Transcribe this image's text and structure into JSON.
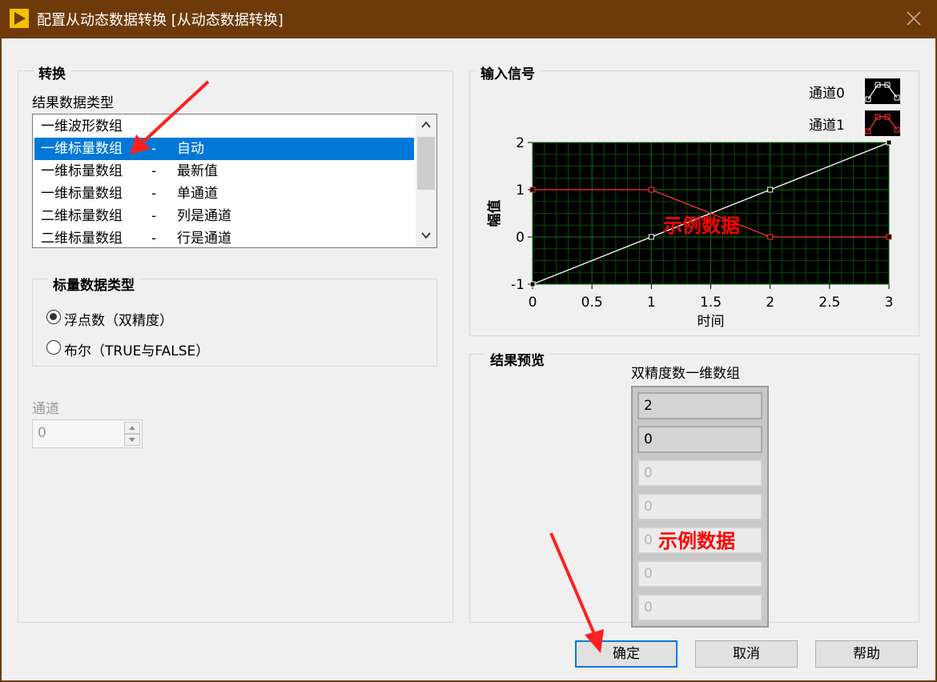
{
  "window": {
    "title": "配置从动态数据转换 [从动态数据转换]"
  },
  "conversion": {
    "group_title": "转换",
    "result_type_label": "结果数据类型",
    "items": [
      {
        "name": "一维波形数组",
        "sep": "",
        "mode": ""
      },
      {
        "name": "一维标量数组",
        "sep": "-",
        "mode": "自动"
      },
      {
        "name": "一维标量数组",
        "sep": "-",
        "mode": "最新值"
      },
      {
        "name": "一维标量数组",
        "sep": "-",
        "mode": "单通道"
      },
      {
        "name": "二维标量数组",
        "sep": "-",
        "mode": "列是通道"
      },
      {
        "name": "二维标量数组",
        "sep": "-",
        "mode": "行是通道"
      }
    ],
    "selected_index": 1
  },
  "scalar_type": {
    "group_title": "标量数据类型",
    "options": [
      "浮点数（双精度）",
      "布尔（TRUE与FALSE）"
    ],
    "selected": 0
  },
  "channel": {
    "label": "通道",
    "value": "0"
  },
  "input_signal": {
    "group_title": "输入信号",
    "legend": [
      "通道0",
      "通道1"
    ],
    "watermark": "示例数据"
  },
  "chart_data": {
    "type": "line",
    "title": "",
    "xlabel": "时间",
    "ylabel": "幅值",
    "xlim": [
      0,
      3
    ],
    "ylim": [
      -1,
      2
    ],
    "x_ticks": [
      "0",
      "0.5",
      "1",
      "1.5",
      "2",
      "2.5",
      "3"
    ],
    "y_ticks": [
      "2",
      "1",
      "0",
      "-1"
    ],
    "grid": true,
    "legend_position": "top-right",
    "series": [
      {
        "name": "通道0",
        "color": "#ffffff",
        "x": [
          0,
          1,
          2,
          3
        ],
        "y": [
          -1,
          0,
          1,
          2
        ]
      },
      {
        "name": "通道1",
        "color": "#ff3030",
        "x": [
          0,
          1,
          2,
          3
        ],
        "y": [
          1,
          1,
          0,
          0
        ]
      }
    ]
  },
  "preview": {
    "group_title": "结果预览",
    "array_label": "双精度数一维数组",
    "values": [
      "2",
      "0",
      "0",
      "0",
      "0",
      "0",
      "0"
    ],
    "active_count": 2,
    "watermark": "示例数据"
  },
  "buttons": {
    "ok": "确定",
    "cancel": "取消",
    "help": "帮助"
  },
  "colors": {
    "titlebar": "#6e3a0a",
    "selection": "#0078d7",
    "annotation": "#ff0000"
  }
}
